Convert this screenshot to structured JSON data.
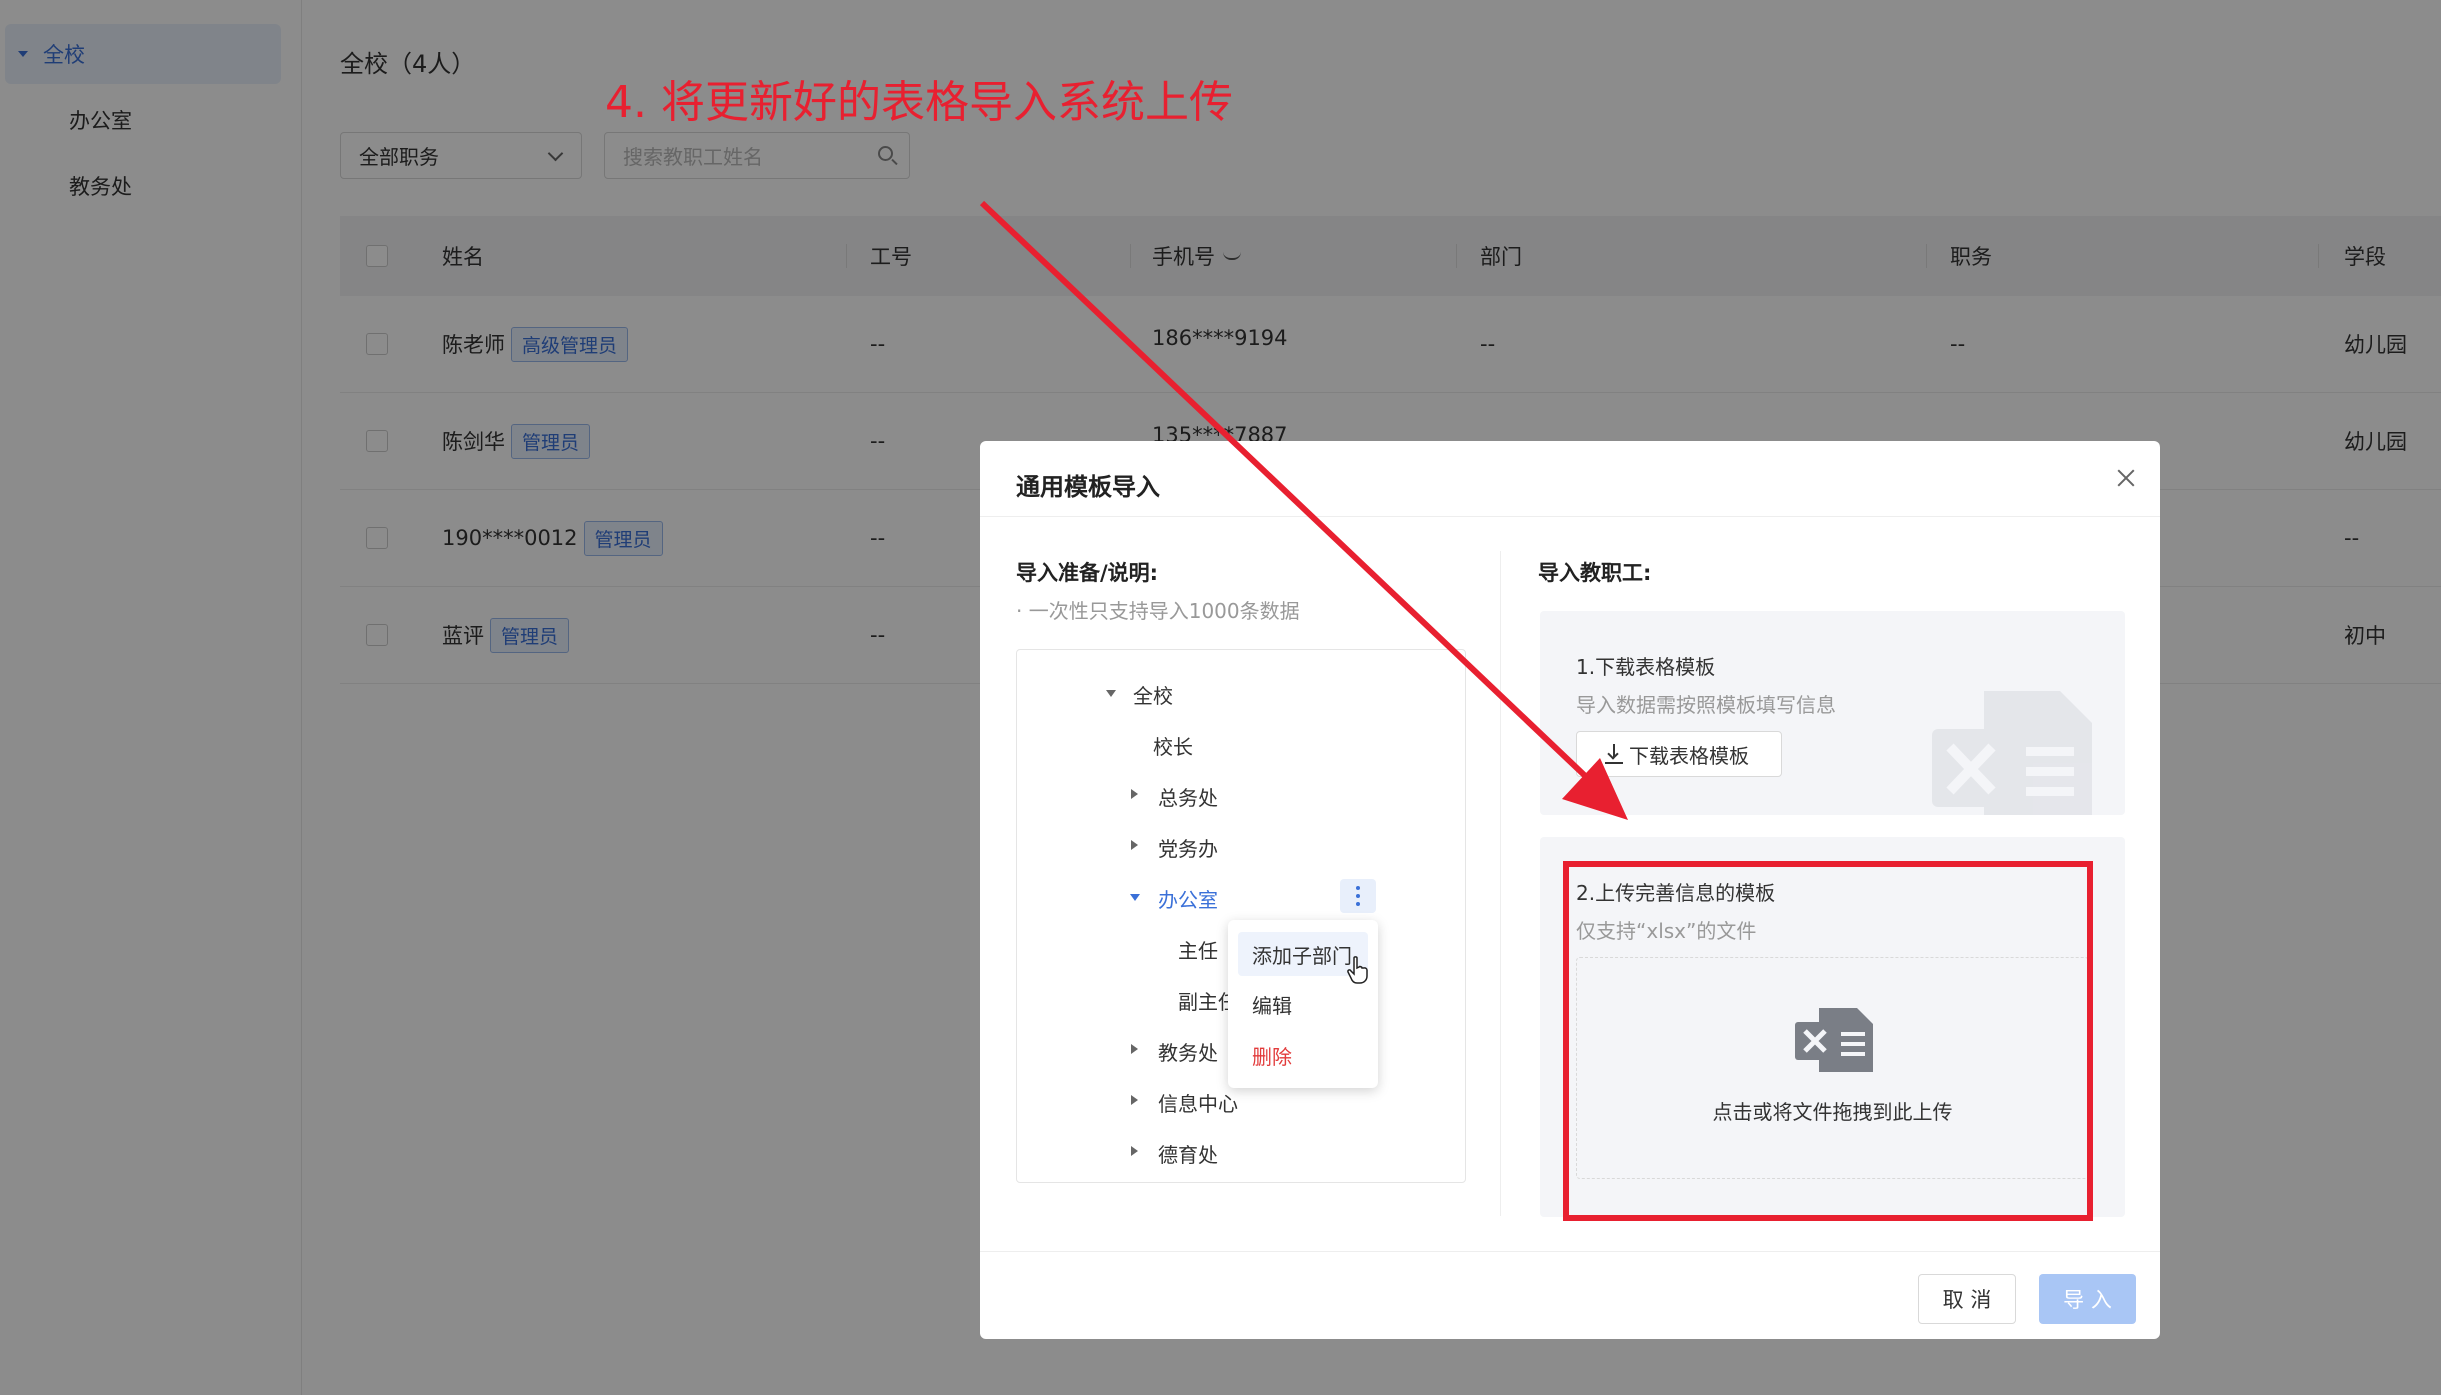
{
  "sidebar": {
    "items": [
      {
        "label": "全校",
        "active": true
      },
      {
        "label": "办公室"
      },
      {
        "label": "教务处"
      }
    ]
  },
  "header": {
    "title": "全校（4人）"
  },
  "filters": {
    "role_select": "全部职务",
    "search_placeholder": "搜索教职工姓名"
  },
  "table": {
    "columns": [
      "姓名",
      "工号",
      "手机号",
      "部门",
      "职务",
      "学段"
    ],
    "rows": [
      {
        "name": "陈老师",
        "badge": "高级管理员",
        "id": "--",
        "phone": "186****9194",
        "dept": "--",
        "role": "--",
        "stage": "幼儿园"
      },
      {
        "name": "陈剑华",
        "badge": "管理员",
        "id": "--",
        "phone": "135****7887",
        "dept": "",
        "role": "",
        "stage": "幼儿园"
      },
      {
        "name": "190****0012",
        "badge": "管理员",
        "id": "--",
        "phone": "",
        "dept": "",
        "role": "",
        "stage": "--"
      },
      {
        "name": "蓝评",
        "badge": "管理员",
        "id": "--",
        "phone": "",
        "dept": "",
        "role": "",
        "stage": "初中"
      }
    ]
  },
  "annotation": {
    "text": "4. 将更新好的表格导入系统上传",
    "color": "#e82030"
  },
  "modal": {
    "title": "通用模板导入",
    "prep_title": "导入准备/说明:",
    "prep_note": "· 一次性只支持导入1000条数据",
    "tree": {
      "root": "全校",
      "principal": "校长",
      "n1": "总务处",
      "n2": "党务办",
      "n3": "办公室",
      "n3_child1": "主任",
      "n3_child2": "副主任",
      "n4": "教务处",
      "n5": "信息中心",
      "n6": "德育处"
    },
    "context_menu": [
      "添加子部门",
      "编辑",
      "删除"
    ],
    "import_title": "导入教职工:",
    "step1": {
      "title": "1.下载表格模板",
      "desc": "导入数据需按照模板填写信息",
      "button": "下载表格模板"
    },
    "step2": {
      "title": "2.上传完善信息的模板",
      "desc": "仅支持“xlsx”的文件",
      "drop_text": "点击或将文件拖拽到此上传"
    },
    "cancel": "取 消",
    "import": "导 入"
  },
  "colors": {
    "accent": "#3a70d8",
    "danger": "#e23b3b",
    "highlight": "#e82030",
    "import_disabled": "#a9c6f5"
  }
}
